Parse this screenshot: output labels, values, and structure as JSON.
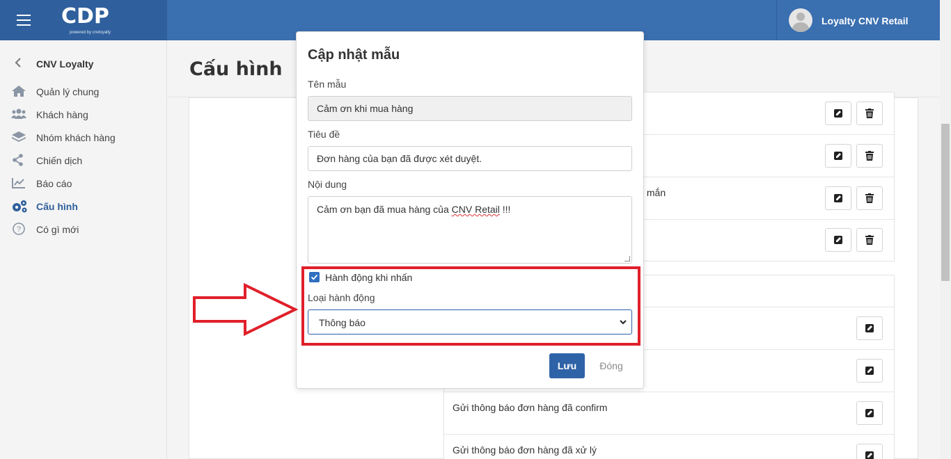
{
  "header": {
    "logo": "CDP",
    "logo_sub": "powered by cnvloyalty",
    "user_name": "Loyalty CNV Retail"
  },
  "sidebar": {
    "title": "CNV Loyalty",
    "items": [
      {
        "label": "Quản lý chung",
        "icon": "home-icon"
      },
      {
        "label": "Khách hàng",
        "icon": "users-icon"
      },
      {
        "label": "Nhóm khách hàng",
        "icon": "layers-icon"
      },
      {
        "label": "Chiến dịch",
        "icon": "share-icon"
      },
      {
        "label": "Báo cáo",
        "icon": "chart-icon"
      },
      {
        "label": "Cấu hình",
        "icon": "gears-icon",
        "active": true
      },
      {
        "label": "Có gì mới",
        "icon": "help-icon"
      }
    ]
  },
  "main": {
    "title": "Cấu hình",
    "rows_a": [
      {
        "text": ""
      },
      {
        "text": ""
      },
      {
        "text": "y mắn"
      },
      {
        "text": ""
      }
    ],
    "rows_b": [
      {
        "text": ""
      },
      {
        "text": ""
      },
      {
        "text": "Gửi thông báo đơn hàng đã confirm"
      },
      {
        "text": "Gửi thông báo đơn hàng đã xử lý"
      }
    ]
  },
  "modal": {
    "title": "Cập nhật mẫu",
    "name_label": "Tên mẫu",
    "name_value": "Cảm ơn khi mua hàng",
    "subject_label": "Tiêu đề",
    "subject_value": "Đơn hàng của bạn đã được xét duyệt.",
    "content_label": "Nội dung",
    "content_before": "Cảm ơn bạn đã mua hàng của ",
    "content_misspelled": "CNV Retail",
    "content_after": " !!!",
    "action_checkbox_label": "Hành động khi nhấn",
    "action_checked": true,
    "action_type_label": "Loại hành động",
    "action_type_value": "Thông báo",
    "save_label": "Lưu",
    "close_label": "Đóng"
  },
  "colors": {
    "topbar": "#3a6fb0",
    "accent": "#2f63a8",
    "highlight": "#e0202a"
  }
}
